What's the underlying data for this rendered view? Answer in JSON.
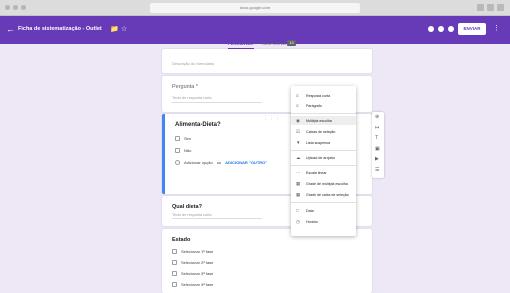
{
  "browser": {
    "address": "docs.google.com"
  },
  "header": {
    "back_icon": "arrow-left-icon",
    "title": "Ficha de sistematização - Outlet",
    "send_label": "ENVIAR",
    "accent": "#673ab7"
  },
  "tabs": {
    "questions": "PERGUNTAS",
    "responses": "RESPOSTAS",
    "response_count": "13"
  },
  "form": {
    "description_placeholder": "Descrição do formulário",
    "pergunta": {
      "title": "Pergunta *",
      "hint": "Texto de resposta curta"
    },
    "active_question": {
      "title": "Alimenta-Dieta?",
      "options": [
        "Sim",
        "Não"
      ],
      "add_option": "Adicionar opção",
      "or": " ou ",
      "add_other": "ADICIONAR \"OUTRO\""
    },
    "qual_dieta": {
      "title": "Qual dieta?",
      "hint": "Texto de resposta curta"
    },
    "estado": {
      "title": "Estado",
      "options": [
        "Selecionar 1ª fase",
        "Selecionar 2ª fase",
        "Selecionar 3ª fase",
        "Selecionar 4ª fase"
      ]
    }
  },
  "menu": {
    "items": [
      {
        "icon": "short-text-icon",
        "label": "Resposta curta"
      },
      {
        "icon": "paragraph-icon",
        "label": "Parágrafo"
      },
      {
        "icon": "checkbox-list-icon",
        "label": "Múltipla escolha"
      },
      {
        "icon": "checkbox-icon",
        "label": "Caixas de seleção"
      },
      {
        "icon": "dropdown-icon",
        "label": "Lista suspensa"
      },
      {
        "icon": "upload-icon",
        "label": "Upload de arquivo"
      },
      {
        "icon": "linear-scale-icon",
        "label": "Escala linear"
      },
      {
        "icon": "grid-icon",
        "label": "Grade de múltipla escolha"
      },
      {
        "icon": "checkbox-grid-icon",
        "label": "Grade de caixa de seleção"
      },
      {
        "icon": "date-icon",
        "label": "Data"
      },
      {
        "icon": "time-icon",
        "label": "Horário"
      }
    ],
    "selected_index": 2
  }
}
